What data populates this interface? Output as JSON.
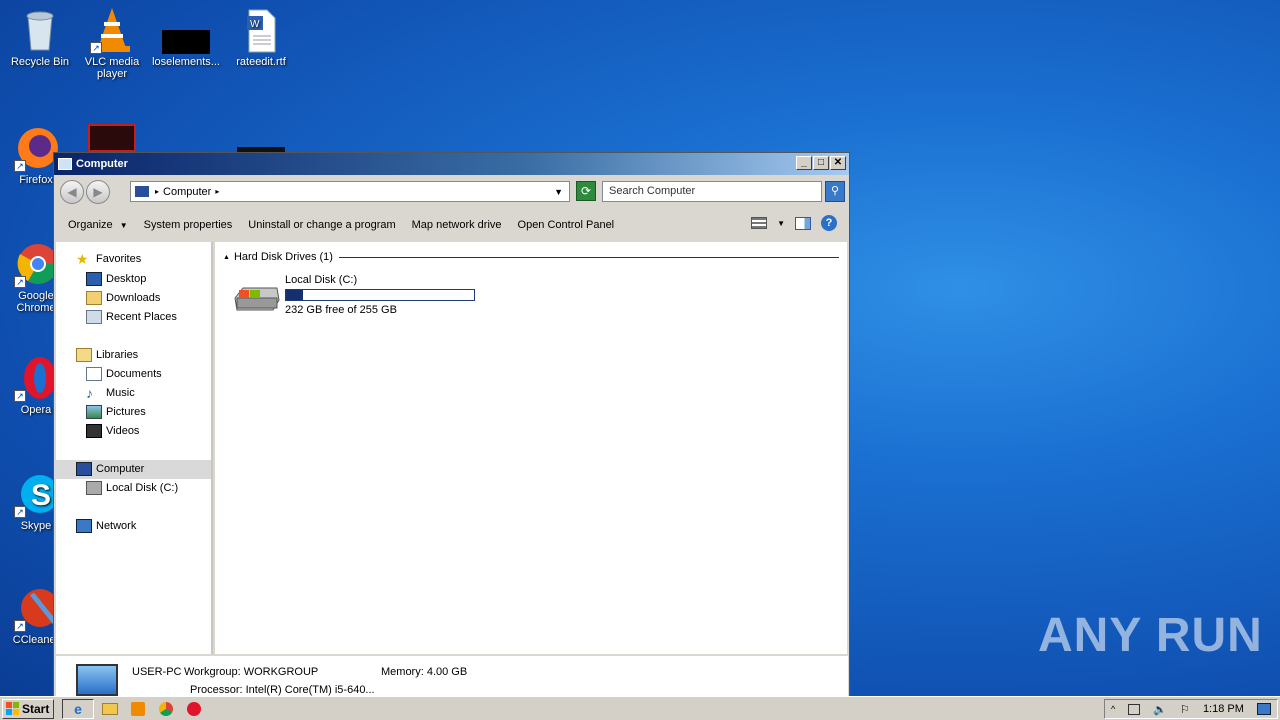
{
  "desktop": {
    "icons": [
      {
        "label": "Recycle Bin"
      },
      {
        "label": "VLC media player"
      },
      {
        "label": "loselements..."
      },
      {
        "label": "rateedit.rtf"
      },
      {
        "label": "Firefox"
      },
      {
        "label": "Google Chrome"
      },
      {
        "label": "Opera"
      },
      {
        "label": "Skype"
      },
      {
        "label": "CCleaner"
      }
    ],
    "watermark_text": "ANY RUN"
  },
  "window": {
    "title": "Computer",
    "address": "Computer",
    "search_placeholder": "Search Computer",
    "toolbar": {
      "organize": "Organize",
      "system_properties": "System properties",
      "uninstall": "Uninstall or change a program",
      "map_drive": "Map network drive",
      "control_panel": "Open Control Panel"
    },
    "nav": {
      "favorites": "Favorites",
      "desktop": "Desktop",
      "downloads": "Downloads",
      "recent_places": "Recent Places",
      "libraries": "Libraries",
      "documents": "Documents",
      "music": "Music",
      "pictures": "Pictures",
      "videos": "Videos",
      "computer": "Computer",
      "local_disk": "Local Disk (C:)",
      "network": "Network"
    },
    "content": {
      "group_header": "Hard Disk Drives (1)",
      "drive_name": "Local Disk (C:)",
      "drive_free": "232 GB free of 255 GB",
      "drive_used_fraction": 0.09
    },
    "details": {
      "pc_name": "USER-PC",
      "workgroup": "Workgroup: WORKGROUP",
      "memory": "Memory: 4.00 GB",
      "processor": "Processor: Intel(R) Core(TM) i5-640..."
    }
  },
  "taskbar": {
    "start_label": "Start",
    "time": "1:18 PM"
  }
}
